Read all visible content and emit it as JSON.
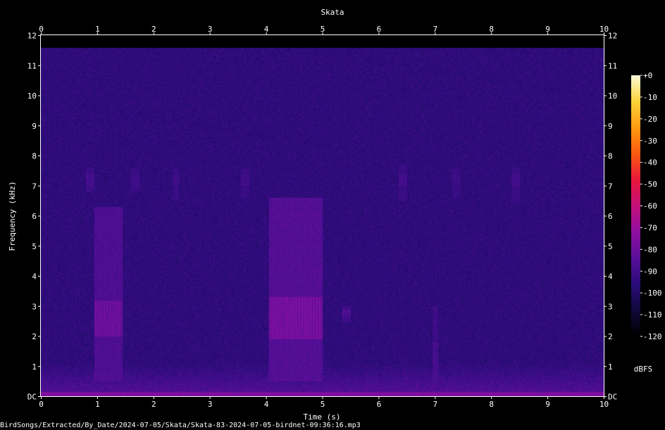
{
  "chart_data": {
    "type": "heatmap",
    "title": "Skata",
    "xlabel": "Time (s)",
    "ylabel": "Frequency (kHz)",
    "xlim": [
      0,
      10
    ],
    "ylim": [
      0,
      12
    ],
    "x_ticks": [
      "0",
      "1",
      "2",
      "3",
      "4",
      "5",
      "6",
      "7",
      "8",
      "9",
      "10"
    ],
    "y_ticks": [
      "DC",
      "1",
      "2",
      "3",
      "4",
      "5",
      "6",
      "7",
      "8",
      "9",
      "10",
      "11",
      "12"
    ],
    "colorbar": {
      "label": "dBFS",
      "range": [
        -120,
        0
      ],
      "ticks": [
        "+0",
        "-10",
        "-20",
        "-30",
        "-40",
        "-50",
        "-60",
        "-70",
        "-80",
        "-90",
        "-100",
        "-110",
        "-120"
      ],
      "colors": [
        "#000000",
        "#10083a",
        "#2a0c7a",
        "#5a0f9a",
        "#8e0f9f",
        "#c4107a",
        "#e8163a",
        "#fa5a10",
        "#fd9a10",
        "#fdd23a",
        "#fffbd8"
      ]
    },
    "background_level_dbfs": -95,
    "max_frequency_khz": 11.6,
    "events": [
      {
        "t_start": 0.95,
        "t_end": 1.45,
        "f_low": 0.5,
        "f_high": 6.3,
        "peak_f_low": 2.0,
        "peak_f_high": 3.2,
        "level_dbfs": -78
      },
      {
        "t_start": 4.05,
        "t_end": 5.0,
        "f_low": 0.5,
        "f_high": 6.6,
        "peak_f_low": 1.9,
        "peak_f_high": 3.3,
        "level_dbfs": -75
      },
      {
        "t_start": 5.35,
        "t_end": 5.5,
        "f_low": 2.5,
        "f_high": 3.0,
        "peak_f_low": 2.7,
        "peak_f_high": 2.9,
        "level_dbfs": -85
      },
      {
        "t_start": 6.95,
        "t_end": 7.05,
        "f_low": 0.2,
        "f_high": 3.0,
        "peak_f_low": 0.3,
        "peak_f_high": 1.8,
        "level_dbfs": -88
      },
      {
        "t_start": 0.8,
        "t_end": 0.95,
        "f_low": 6.8,
        "f_high": 7.6,
        "peak_f_low": 7.0,
        "peak_f_high": 7.4,
        "level_dbfs": -88
      },
      {
        "t_start": 1.6,
        "t_end": 1.75,
        "f_low": 6.8,
        "f_high": 7.6,
        "peak_f_low": 7.0,
        "peak_f_high": 7.4,
        "level_dbfs": -90
      },
      {
        "t_start": 2.35,
        "t_end": 2.45,
        "f_low": 6.5,
        "f_high": 7.6,
        "peak_f_low": 7.0,
        "peak_f_high": 7.4,
        "level_dbfs": -90
      },
      {
        "t_start": 3.55,
        "t_end": 3.7,
        "f_low": 6.6,
        "f_high": 7.6,
        "peak_f_low": 7.0,
        "peak_f_high": 7.4,
        "level_dbfs": -90
      },
      {
        "t_start": 6.35,
        "t_end": 6.5,
        "f_low": 6.5,
        "f_high": 7.7,
        "peak_f_low": 7.0,
        "peak_f_high": 7.4,
        "level_dbfs": -89
      },
      {
        "t_start": 7.3,
        "t_end": 7.45,
        "f_low": 6.6,
        "f_high": 7.6,
        "peak_f_low": 7.0,
        "peak_f_high": 7.4,
        "level_dbfs": -91
      },
      {
        "t_start": 8.35,
        "t_end": 8.5,
        "f_low": 6.5,
        "f_high": 7.6,
        "peak_f_low": 7.0,
        "peak_f_high": 7.4,
        "level_dbfs": -89
      }
    ]
  },
  "footer": {
    "file_path": "BirdSongs/Extracted/By_Date/2024-07-05/Skata/Skata-83-2024-07-05-birdnet-09:36:16.mp3"
  }
}
